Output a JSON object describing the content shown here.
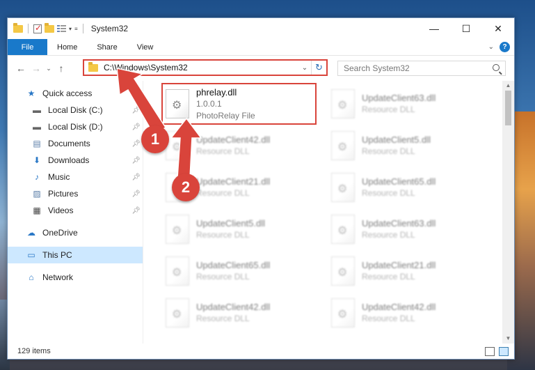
{
  "window": {
    "title": "System32",
    "controls": {
      "minimize": "—",
      "maximize": "☐",
      "close": "✕"
    }
  },
  "ribbon": {
    "tabs": [
      {
        "label": "File"
      },
      {
        "label": "Home"
      },
      {
        "label": "Share"
      },
      {
        "label": "View"
      }
    ]
  },
  "address": {
    "path": "C:\\Windows\\System32",
    "refresh_icon": "↻"
  },
  "search": {
    "placeholder": "Search System32"
  },
  "sidebar": {
    "items": [
      {
        "label": "Quick access",
        "icon": "★",
        "pinned": false
      },
      {
        "label": "Local Disk (C:)",
        "icon": "▬",
        "pinned": true
      },
      {
        "label": "Local Disk (D:)",
        "icon": "▬",
        "pinned": true
      },
      {
        "label": "Documents",
        "icon": "▤",
        "pinned": true
      },
      {
        "label": "Downloads",
        "icon": "⬇",
        "pinned": true
      },
      {
        "label": "Music",
        "icon": "♪",
        "pinned": true
      },
      {
        "label": "Pictures",
        "icon": "▨",
        "pinned": true
      },
      {
        "label": "Videos",
        "icon": "▦",
        "pinned": true
      },
      {
        "label": "OneDrive",
        "icon": "☁",
        "pinned": false
      },
      {
        "label": "This PC",
        "icon": "▭",
        "pinned": false
      },
      {
        "label": "Network",
        "icon": "⌂",
        "pinned": false
      }
    ]
  },
  "files": {
    "highlighted": {
      "name": "phrelay.dll",
      "version": "1.0.0.1",
      "type": "PhotoRelay File"
    },
    "left_column": [
      {
        "name": "UpdateClient42.dll",
        "type": "Resource DLL"
      },
      {
        "name": "UpdateClient21.dll",
        "type": "Resource DLL"
      },
      {
        "name": "UpdateClient5.dll",
        "type": "Resource DLL"
      },
      {
        "name": "UpdateClient65.dll",
        "type": "Resource DLL"
      },
      {
        "name": "UpdateClient42.dll",
        "type": "Resource DLL"
      }
    ],
    "right_column": [
      {
        "name": "UpdateClient63.dll",
        "type": "Resource DLL"
      },
      {
        "name": "UpdateClient5.dll",
        "type": "Resource DLL"
      },
      {
        "name": "UpdateClient65.dll",
        "type": "Resource DLL"
      },
      {
        "name": "UpdateClient63.dll",
        "type": "Resource DLL"
      },
      {
        "name": "UpdateClient21.dll",
        "type": "Resource DLL"
      },
      {
        "name": "UpdateClient42.dll",
        "type": "Resource DLL"
      }
    ]
  },
  "status": {
    "item_count": "129 items"
  },
  "annotations": {
    "badge1": "1",
    "badge2": "2",
    "color": "#d9443b"
  }
}
